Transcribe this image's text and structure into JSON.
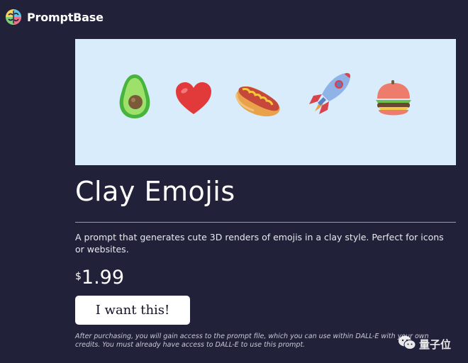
{
  "header": {
    "brand": "PromptBase",
    "logo_icon": "brain-logo-icon"
  },
  "hero": {
    "emojis": [
      "avocado-icon",
      "heart-icon",
      "hotdog-icon",
      "rocket-icon",
      "burger-icon"
    ],
    "background": "#d9ecfb"
  },
  "product": {
    "title": "Clay Emojis",
    "description": "A prompt that generates cute 3D renders of emojis in a clay style. Perfect for icons or websites.",
    "price_currency": "$",
    "price_amount": "1.99",
    "buy_label": "I want this!",
    "note": "After purchasing, you will gain access to the prompt file, which you can use within DALL-E with your own credits. You must already have access to DALL-E to use this prompt."
  },
  "watermark": {
    "text": "量子位",
    "icon": "wechat-icon"
  },
  "colors": {
    "page_bg": "#21213a",
    "button_bg": "#ffffff",
    "divider": "#9a9aae"
  }
}
